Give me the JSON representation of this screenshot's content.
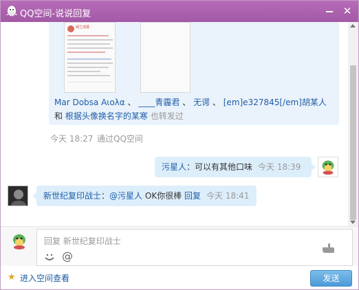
{
  "window": {
    "title": "QQ空间-说说回复"
  },
  "share": {
    "mini_post": {
      "name": "晴兰洗蔵"
    },
    "text": {
      "n1": "Mar Dobsa Αιολα",
      "n2": "____青霾君",
      "n3": "无谔",
      "n4": "[em]e327845[/em]胡某人",
      "and": "和",
      "n5": "根据头像换名字的某寒",
      "suffix": "也转发过",
      "sep": "、"
    },
    "time": "今天 18:27",
    "via": "通过QQ空间"
  },
  "messages": [
    {
      "sender": "污星人",
      "colon": "：",
      "text": "可以有其他口味",
      "time": "今天 18:39"
    },
    {
      "sender": "新世纪复印战士",
      "colon": "：",
      "mention": "@污星人",
      "text": "OK你很棒",
      "action": "回复",
      "time": "今天 18:41"
    }
  ],
  "input": {
    "placeholder": "回复 新世纪复印战士"
  },
  "footer": {
    "enter_space": "进入空间查看",
    "send": "发送"
  },
  "icons": {
    "logo": "qq-penguin-icon",
    "smile": "smile-icon",
    "at": "at-icon",
    "hand": "hand-icon",
    "star": "star-icon"
  },
  "colors": {
    "title_bar": "#a259a6",
    "bubble": "#ddeefb",
    "link": "#1f5ea8",
    "send": "#4e9bd9"
  }
}
